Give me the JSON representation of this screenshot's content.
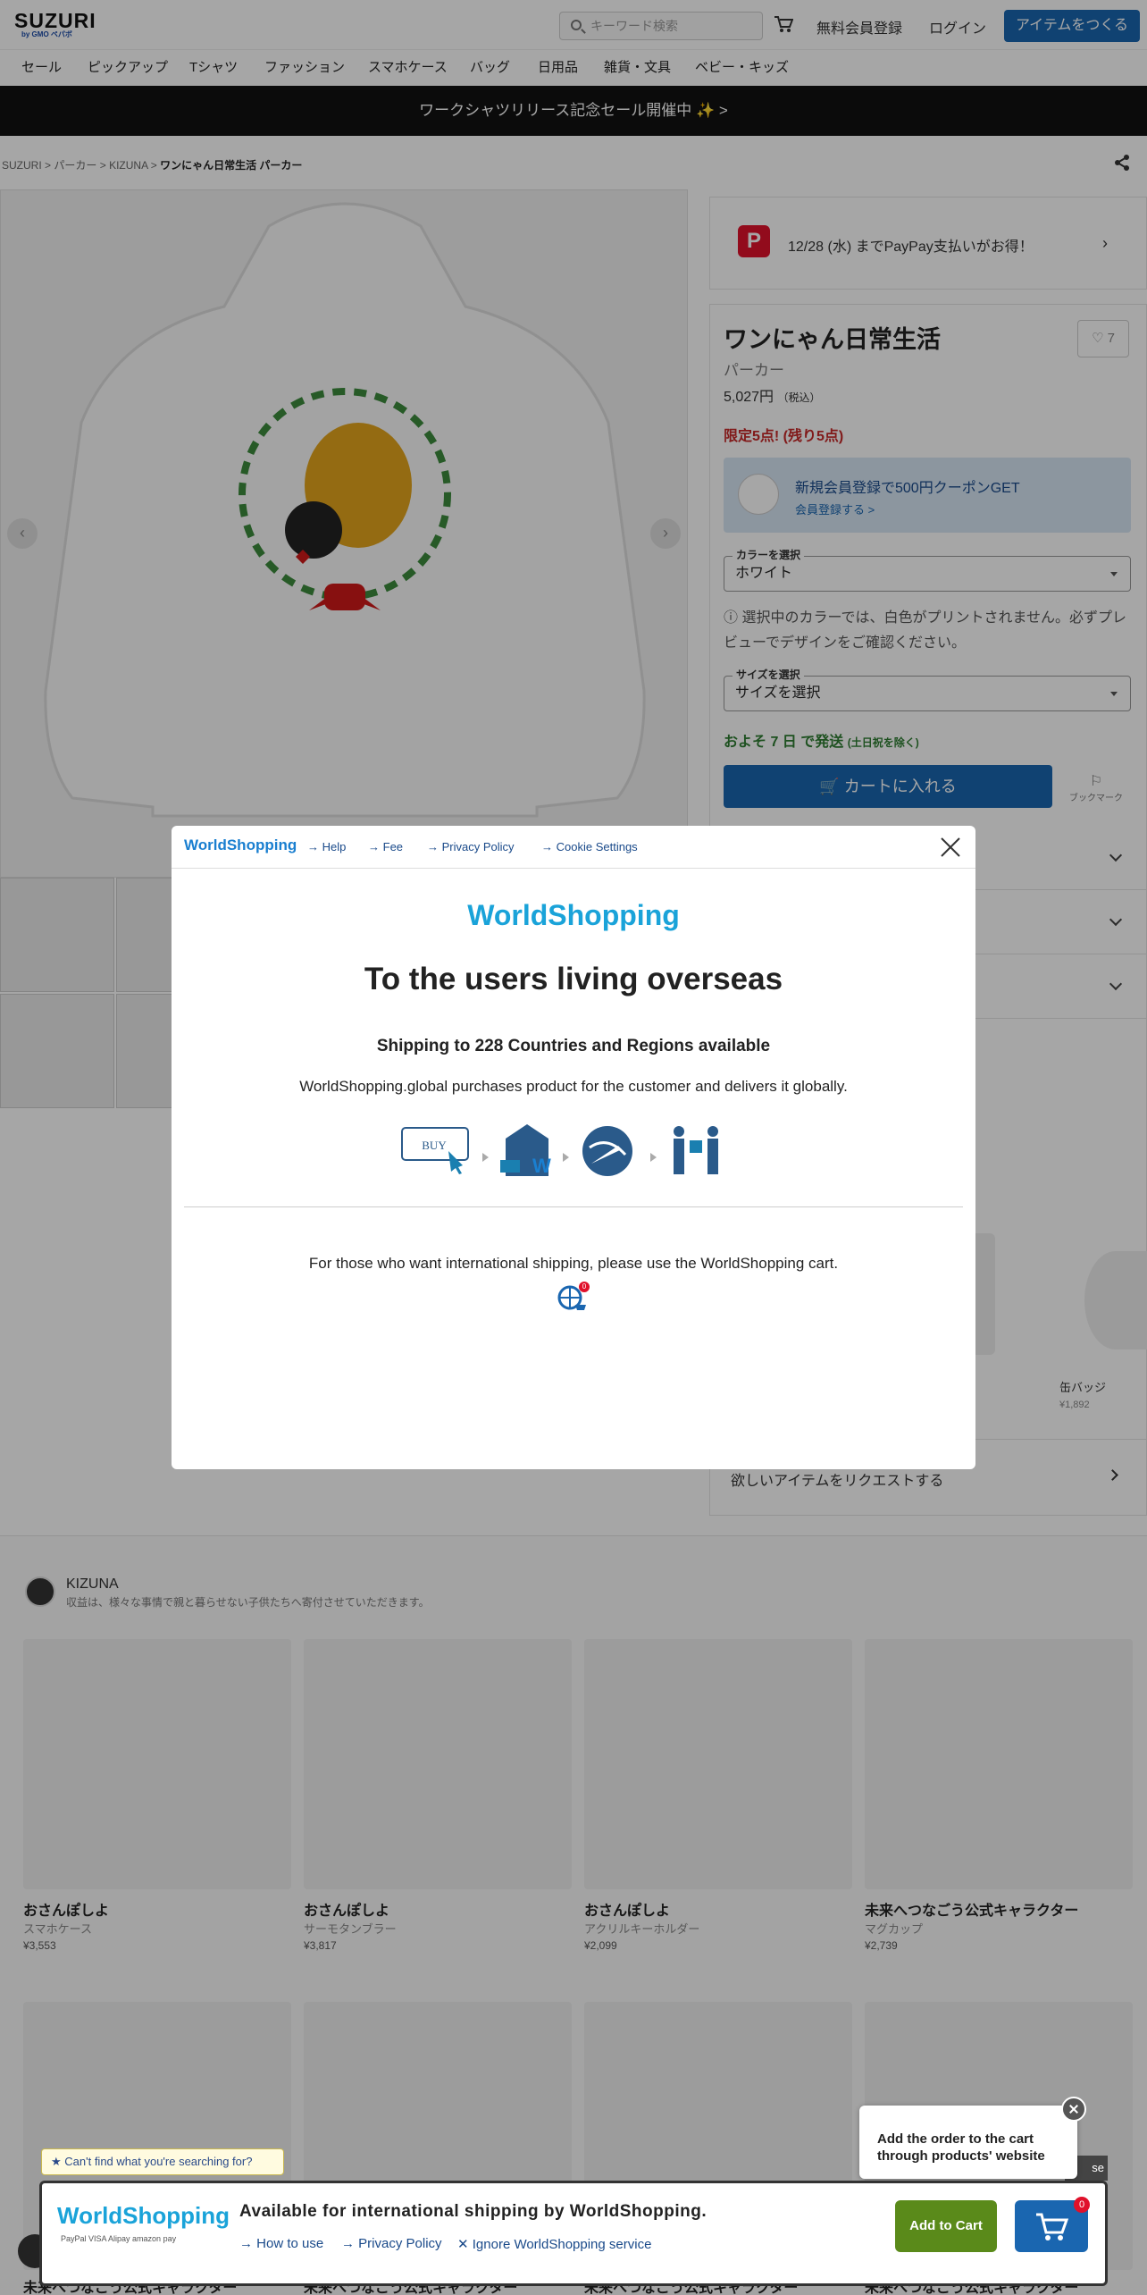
{
  "header": {
    "logo": "SUZURI",
    "logo_sub": "by GMO ペパボ",
    "search_placeholder": "キーワード検索",
    "signup": "無料会員登録",
    "login": "ログイン",
    "make_item": "アイテムをつくる"
  },
  "nav": [
    "セール",
    "ピックアップ",
    "Tシャツ",
    "ファッション",
    "スマホケース",
    "バッグ",
    "日用品",
    "雑貨・文具",
    "ベビー・キッズ"
  ],
  "banner": "ワークシャツリリース記念セール開催中 ✨ >",
  "breadcrumb": {
    "items": [
      "SUZURI",
      "パーカー",
      "KIZUNA"
    ],
    "current": "ワンにゃん日常生活 パーカー"
  },
  "paypay": {
    "logo": "P",
    "text": "12/28 (水) までPayPay支払いがお得！"
  },
  "product": {
    "title": "ワンにゃん日常生活",
    "fav_count": "♡ 7",
    "type": "パーカー",
    "price": "5,027円",
    "tax": "（税込）",
    "limited": "限定5点! (残り5点)",
    "coupon_text": "新規会員登録で500円クーポンGET",
    "coupon_link": "会員登録する >",
    "color_label": "カラーを選択",
    "color_value": "ホワイト",
    "color_note": "選択中のカラーでは、白色がプリントされません。必ずプレビューでデザインをご確認ください。",
    "size_label": "サイズを選択",
    "size_value": "サイズを選択",
    "ship": "およそ 7 日 で発送",
    "ship_note": "(土日祝を除く)",
    "add_cart": "カートに入れる",
    "bookmark": "ブックマーク",
    "request": "欲しいアイテムをリクエストする",
    "related": [
      {
        "name": "缶バッジ",
        "price": "¥1,892"
      }
    ]
  },
  "shop": {
    "name": "KIZUNA",
    "desc": "収益は、様々な事情で親と暮らせない子供たちへ寄付させていただきます。",
    "items": [
      {
        "title": "おさんぽしよ",
        "type": "スマホケース",
        "price": "¥3,553"
      },
      {
        "title": "おさんぽしよ",
        "type": "サーモタンブラー",
        "price": "¥3,817"
      },
      {
        "title": "おさんぽしよ",
        "type": "アクリルキーホルダー",
        "price": "¥2,099"
      },
      {
        "title": "未来へつなごう公式キャラクター",
        "type": "マグカップ",
        "price": "¥2,739"
      }
    ],
    "bottom_titles": [
      "未来へつなごう公式キャラクター",
      "未来へつなごう公式キャラクター",
      "未来へつなごう公式キャラクター",
      "未来へつなごう公式キャラクター"
    ]
  },
  "modal": {
    "logo": "WorldShopping",
    "links": [
      "Help",
      "Fee",
      "Privacy Policy",
      "Cookie Settings"
    ],
    "title": "To the users living overseas",
    "subtitle": "Shipping to 228 Countries and Regions available",
    "desc": "WorldShopping.global purchases product for the customer and delivers it globally.",
    "step_buy": "BUY",
    "footer_text": "For those who want international shipping, please use the WorldShopping cart.",
    "globe_badge": "0"
  },
  "worldshopping_bar": {
    "tip": "★ Can't find what you're searching for?",
    "logo": "WorldShopping",
    "payments": "PayPal  VISA  Alipay  amazon pay",
    "title": "Available for international shipping by WorldShopping.",
    "links": [
      "How to use",
      "Privacy Policy",
      "Ignore WorldShopping service"
    ],
    "add_cart": "Add to Cart",
    "cart_badge": "0",
    "bubble": "Add the order to the cart through products' website",
    "close_text": "se"
  }
}
